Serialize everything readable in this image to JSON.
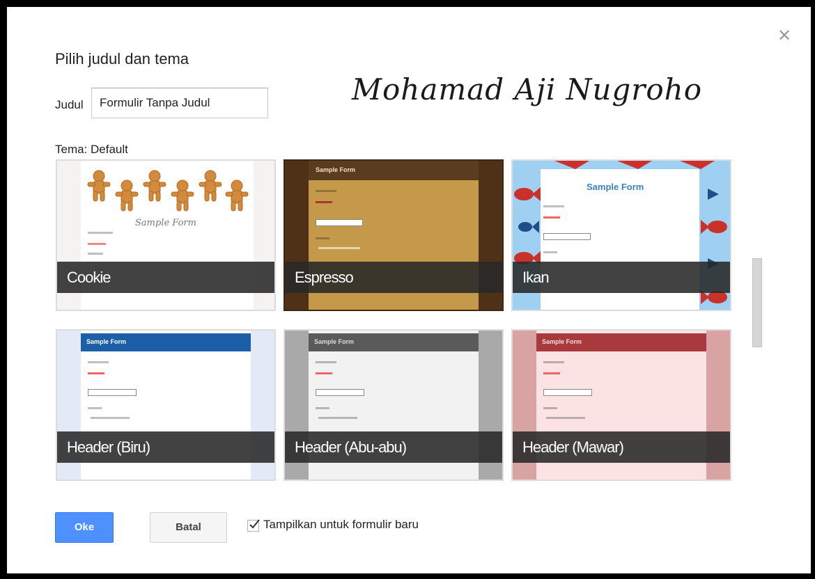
{
  "dialog": {
    "title": "Pilih judul dan tema",
    "close_icon": "close-icon",
    "signature": "Mohamad Aji Nugroho",
    "judul_label": "Judul",
    "judul_value": "Formulir Tanpa Judul",
    "tema_label": "Tema: Default"
  },
  "themes": [
    {
      "name": "Cookie",
      "preview_title": "Sample Form"
    },
    {
      "name": "Espresso",
      "preview_title": "Sample Form"
    },
    {
      "name": "Ikan",
      "preview_title": "Sample Form"
    },
    {
      "name": "Header (Biru)",
      "preview_title": "Sample Form"
    },
    {
      "name": "Header (Abu-abu)",
      "preview_title": "Sample Form"
    },
    {
      "name": "Header (Mawar)",
      "preview_title": "Sample Form"
    }
  ],
  "buttons": {
    "ok_label": "Oke",
    "cancel_label": "Batal"
  },
  "checkbox": {
    "label": "Tampilkan untuk formulir baru",
    "checked": true
  },
  "colors": {
    "ok_button": "#4d90fe",
    "biru": "#1c5ea8",
    "abu": "#5a5a5a",
    "mawar": "#a8393c",
    "espresso": "#c49a4a",
    "ikan_bg": "#9fd0f2",
    "ikan_fish": "#c9312a"
  }
}
